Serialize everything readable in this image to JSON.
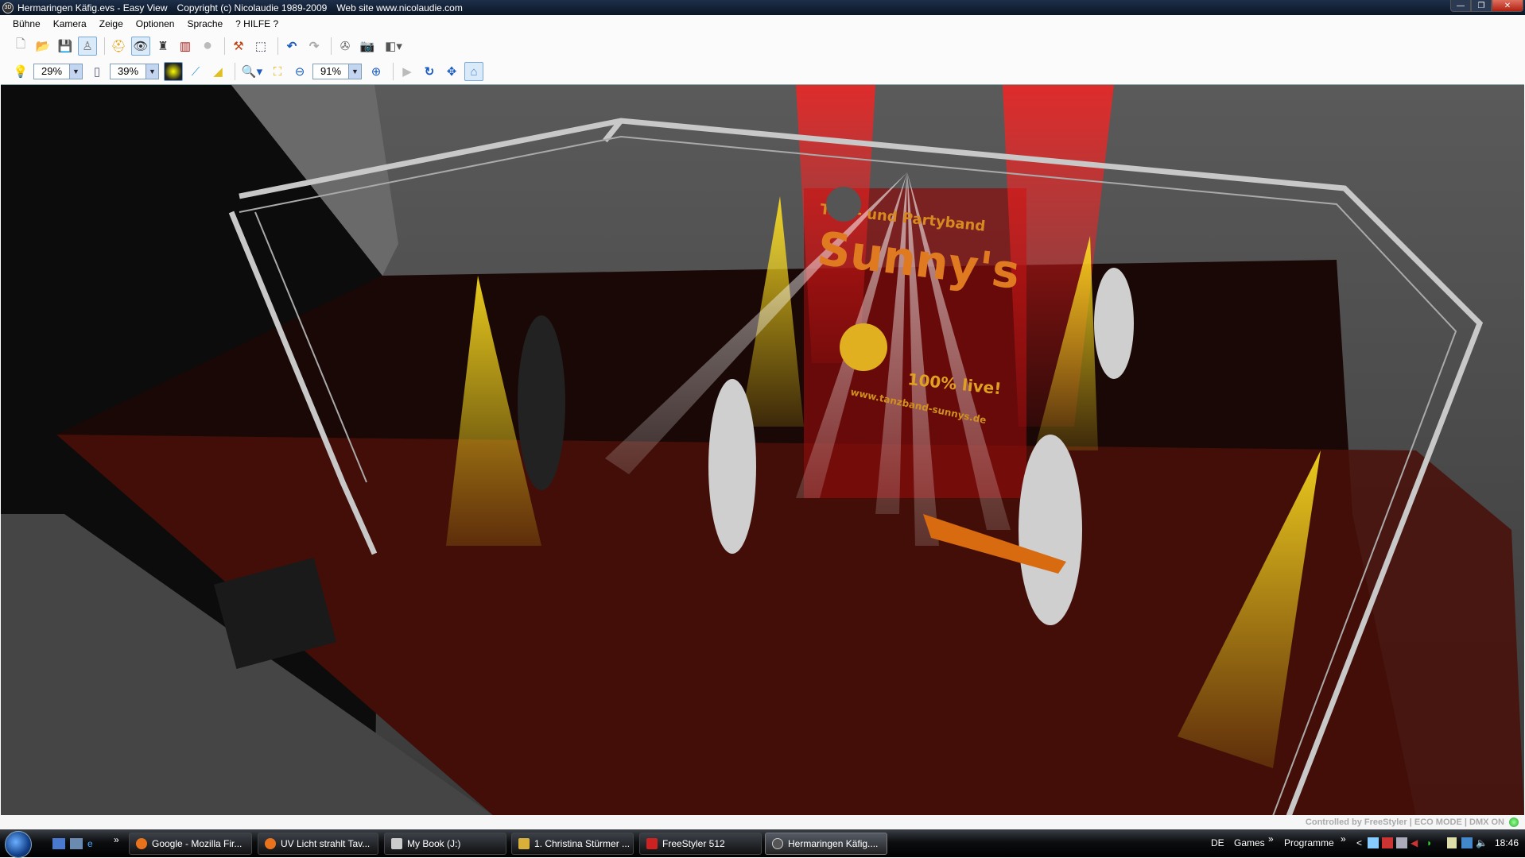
{
  "window": {
    "title": "Hermaringen Käfig.evs - Easy View",
    "copyright": "Copyright (c) Nicolaudie 1989-2009",
    "website": "Web site www.nicolaudie.com",
    "app_icon_text": "3D",
    "controls": {
      "minimize": "—",
      "maximize": "❐",
      "close": "✕"
    }
  },
  "menu": [
    "Bühne",
    "Kamera",
    "Zeige",
    "Optionen",
    "Sprache",
    "? HILFE ?"
  ],
  "toolbar1": [
    {
      "name": "new-file-icon",
      "glyph": "🗋"
    },
    {
      "name": "open-folder-icon",
      "glyph": "📂"
    },
    {
      "name": "save-icon",
      "glyph": "💾"
    },
    {
      "name": "mannequin-icon",
      "glyph": "♙"
    },
    {
      "name": "helmet-icon",
      "glyph": "⛑"
    },
    {
      "name": "eye-icon",
      "glyph": "👁"
    },
    {
      "name": "moving-head-icon",
      "glyph": "♜"
    },
    {
      "name": "dmx-icon",
      "glyph": "▥"
    },
    {
      "name": "record-icon",
      "glyph": "●"
    },
    {
      "name": "stamp-icon",
      "glyph": "⚒"
    },
    {
      "name": "cube-icon",
      "glyph": "⬚"
    },
    {
      "name": "undo-icon",
      "glyph": "↶"
    },
    {
      "name": "redo-icon",
      "glyph": "↷"
    },
    {
      "name": "film-reel-icon",
      "glyph": "✇"
    },
    {
      "name": "camera-icon",
      "glyph": "📷"
    },
    {
      "name": "render-icon",
      "glyph": "◧"
    }
  ],
  "toolbar2": {
    "light_level": "29%",
    "haze_level": "39%",
    "zoom_level": "91%"
  },
  "scene": {
    "banner_line1": "Tanz- und Partyband",
    "banner_name": "Sunny's",
    "banner_tagline": "100% live!",
    "banner_url": "www.tanzband-sunnys.de"
  },
  "status": {
    "controlled_by": "Controlled by FreeStyler",
    "eco_mode": "ECO MODE",
    "dmx": "DMX ON",
    "separator": "|"
  },
  "taskbar": {
    "quicklaunch_more": "»",
    "buttons": [
      {
        "label": "Google - Mozilla Fir...",
        "color": "#e8731c"
      },
      {
        "label": "UV Licht strahlt Tav...",
        "color": "#e8731c"
      },
      {
        "label": "My Book (J:)",
        "color": "#ccc"
      },
      {
        "label": "1. Christina Stürmer ...",
        "color": "#d9b13a"
      },
      {
        "label": "FreeStyler 512",
        "color": "#c22"
      },
      {
        "label": "Hermaringen Käfig....",
        "color": "#666"
      }
    ],
    "language": "DE",
    "toolbar_games": "Games",
    "toolbar_programme": "Programme",
    "chevron": "»",
    "tray_expand": "<",
    "clock": "18:46"
  }
}
